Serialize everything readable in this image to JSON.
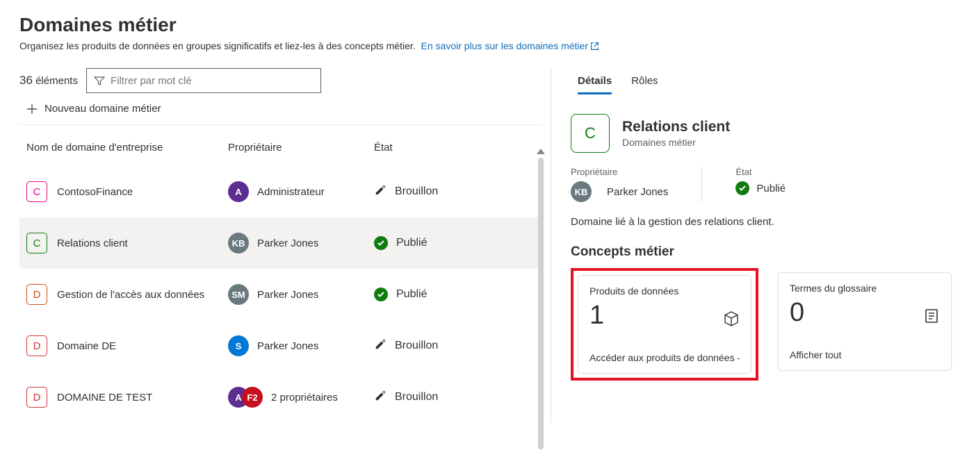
{
  "header": {
    "title": "Domaines métier",
    "subtitle": "Organisez les produits de données en groupes significatifs et liez-les à des concepts métier.",
    "learn_more": "En savoir plus sur les domaines métier"
  },
  "toolbar": {
    "count": "36",
    "count_label": "éléments",
    "filter_placeholder": "Filtrer par mot clé",
    "new_domain": "Nouveau domaine métier"
  },
  "columns": {
    "name": "Nom de domaine d'entreprise",
    "owner": "Propriétaire",
    "state": "État"
  },
  "rows": [
    {
      "letter": "C",
      "cls": "ico-pink",
      "name": "ContosoFinance",
      "avatar_cls": "p-purple",
      "avatar_text": "A",
      "owner": "Administrateur",
      "state": "Brouillon",
      "state_kind": "draft"
    },
    {
      "letter": "C",
      "cls": "ico-green",
      "name": "Relations client",
      "avatar_cls": "p-gray",
      "avatar_text": "KB",
      "owner": "Parker Jones",
      "state": "Publié",
      "state_kind": "published",
      "selected": true
    },
    {
      "letter": "D",
      "cls": "ico-orange",
      "name": "Gestion de l'accès aux données",
      "avatar_cls": "p-gray",
      "avatar_text": "SM",
      "owner": "Parker Jones",
      "state": "Publié",
      "state_kind": "published"
    },
    {
      "letter": "D",
      "cls": "ico-red",
      "name": "Domaine DE",
      "avatar_cls": "p-blue",
      "avatar_text": "S",
      "owner": "Parker Jones",
      "state": "Brouillon",
      "state_kind": "draft"
    },
    {
      "letter": "D",
      "cls": "ico-red",
      "name": "DOMAINE DE TEST",
      "avatars": [
        {
          "cls": "p-purple",
          "text": "A"
        },
        {
          "cls": "p-red",
          "text": "F2"
        }
      ],
      "owner": "2 propriétaires",
      "state": "Brouillon",
      "state_kind": "draft"
    }
  ],
  "detail": {
    "tabs": {
      "details": "Détails",
      "roles": "Rôles"
    },
    "letter": "C",
    "title": "Relations client",
    "subtitle": "Domaines métier",
    "owner_label": "Propriétaire",
    "owner_avatar": "KB",
    "owner_name": "Parker Jones",
    "state_label": "État",
    "state_value": "Publié",
    "description": "Domaine lié à la gestion des relations client.",
    "concepts_heading": "Concepts métier",
    "cards": [
      {
        "title": "Produits de données",
        "count": "1",
        "link": "Accéder aux produits de données -Y",
        "icon": "package",
        "highlight": true
      },
      {
        "title": "Termes du glossaire",
        "count": "0",
        "link": "Afficher tout",
        "icon": "list"
      }
    ]
  }
}
